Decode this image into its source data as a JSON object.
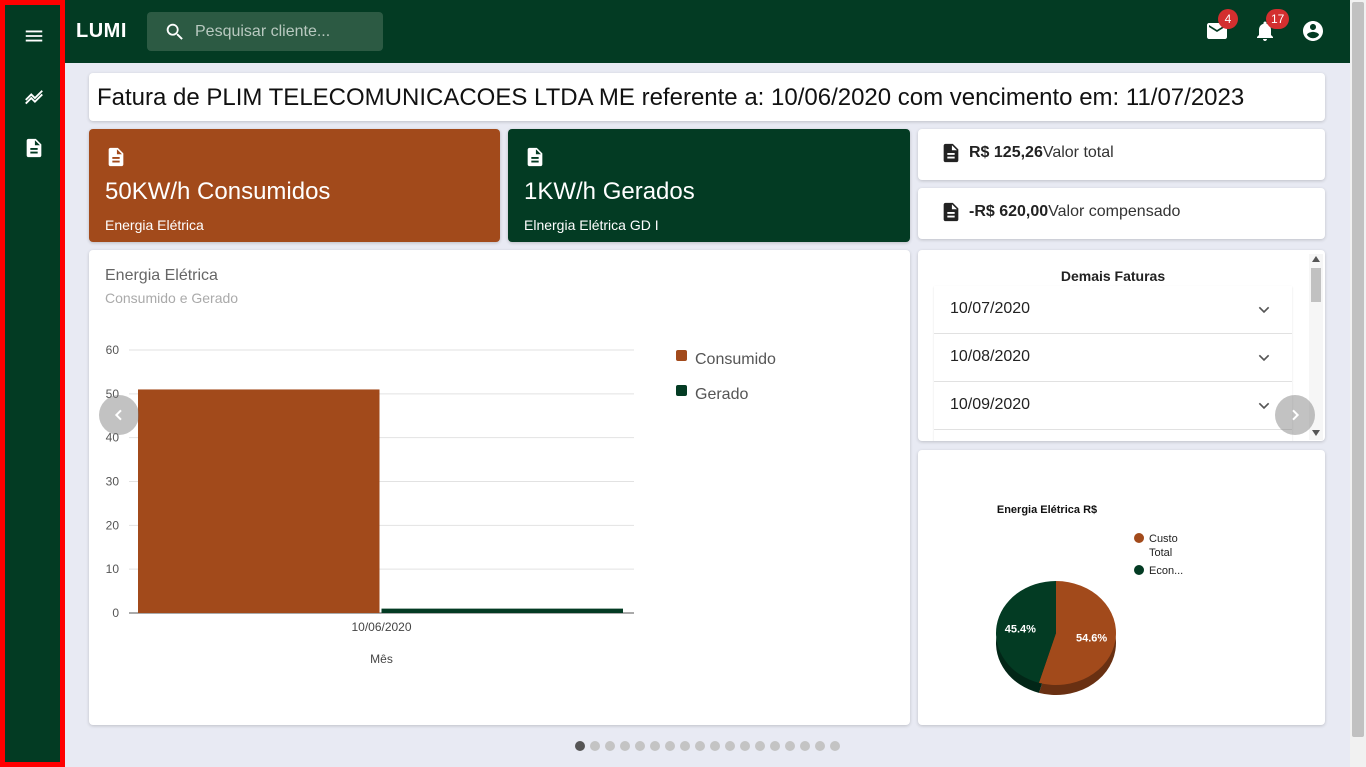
{
  "app": {
    "brand": "LUMI"
  },
  "search": {
    "placeholder": "Pesquisar cliente..."
  },
  "notifications": {
    "mail_count": "4",
    "bell_count": "17"
  },
  "sidebar": {
    "items": [
      "menu-icon",
      "trend-icon",
      "document-icon"
    ]
  },
  "header": {
    "title": "Fatura de PLIM TELECOMUNICACOES LTDA ME referente a: 10/06/2020 com vencimento em: 11/07/2023"
  },
  "stats": [
    {
      "value": "50KW/h Consumidos",
      "label": "Energia Elétrica",
      "color": "#a24a1b"
    },
    {
      "value": "1KW/h Gerados",
      "label": "Elnergia Elétrica GD I",
      "color": "#033b23"
    }
  ],
  "totals": [
    {
      "amount": "R$ 125,26",
      "label": "Valor total"
    },
    {
      "amount": "-R$ 620,00",
      "label": "Valor compensado"
    }
  ],
  "energy_chart": {
    "title": "Energia Elétrica",
    "subtitle": "Consumido e Gerado"
  },
  "invoices": {
    "title": "Demais Faturas",
    "items": [
      "10/07/2020",
      "10/08/2020",
      "10/09/2020"
    ]
  },
  "carousel": {
    "count": 18,
    "active": 0
  },
  "colors": {
    "primary": "#033b23",
    "accent": "#a24a1b"
  },
  "chart_data": [
    {
      "type": "bar",
      "categories": [
        "10/06/2020"
      ],
      "series": [
        {
          "name": "Consumido",
          "values": [
            51
          ],
          "color": "#a24a1b"
        },
        {
          "name": "Gerado",
          "values": [
            1
          ],
          "color": "#033b23"
        }
      ],
      "title": "Energia Elétrica",
      "subtitle": "Consumido e Gerado",
      "xlabel": "Mês",
      "ylabel": "",
      "ylim": [
        0,
        60
      ],
      "yticks": [
        0,
        10,
        20,
        30,
        40,
        50,
        60
      ],
      "grid": true,
      "legend": "right"
    },
    {
      "type": "pie",
      "title": "Energia Elétrica R$",
      "labels": [
        "Custo Total",
        "Econ..."
      ],
      "values": [
        54.6,
        45.4
      ],
      "value_labels": [
        "54.6%",
        "45.4%"
      ],
      "colors": [
        "#a24a1b",
        "#033b23"
      ],
      "legend": "right"
    }
  ]
}
